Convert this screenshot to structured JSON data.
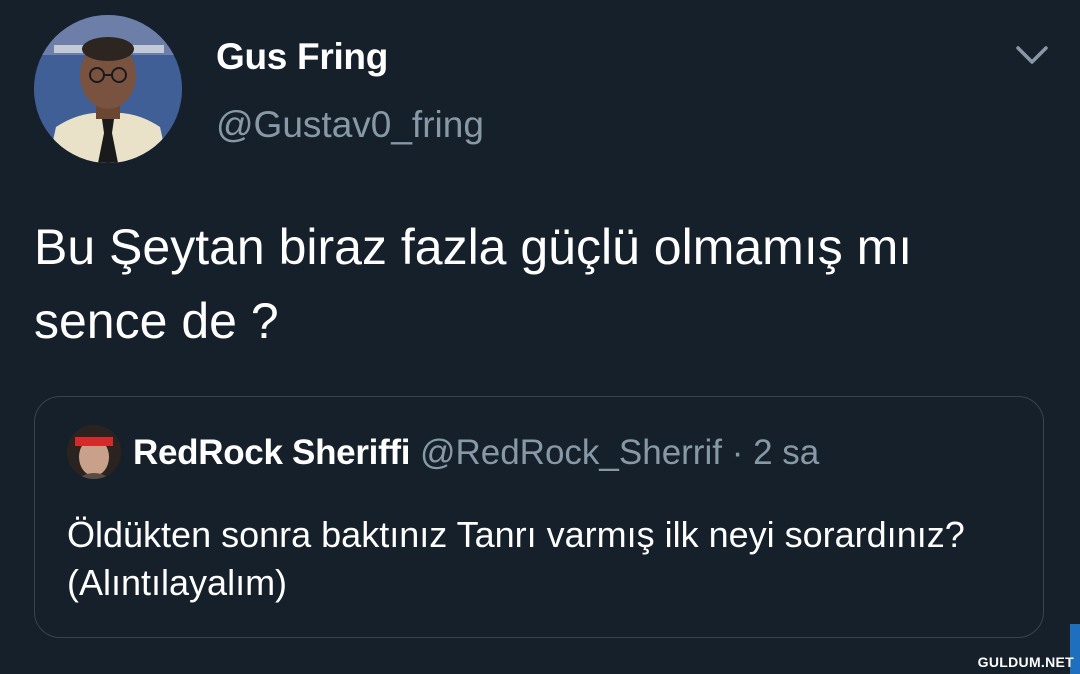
{
  "tweet": {
    "author_name": "Gus Fring",
    "author_handle": "@Gustav0_fring",
    "text": "Bu Şeytan biraz fazla güçlü olmamış mı sence de ?",
    "menu_icon": "chevron-down-icon"
  },
  "quoted_tweet": {
    "author_name": "RedRock Sheriffi",
    "author_handle": "@RedRock_Sherrif",
    "separator": "·",
    "time": "2 sa",
    "text": "Öldükten sonra baktınız Tanrı varmış ilk neyi sorardınız?  (Alıntılayalım)"
  },
  "watermark": "GULDUM.NET",
  "colors": {
    "background": "#15202b",
    "primary_text": "#ffffff",
    "secondary_text": "#8899a6",
    "border": "#38444d"
  }
}
